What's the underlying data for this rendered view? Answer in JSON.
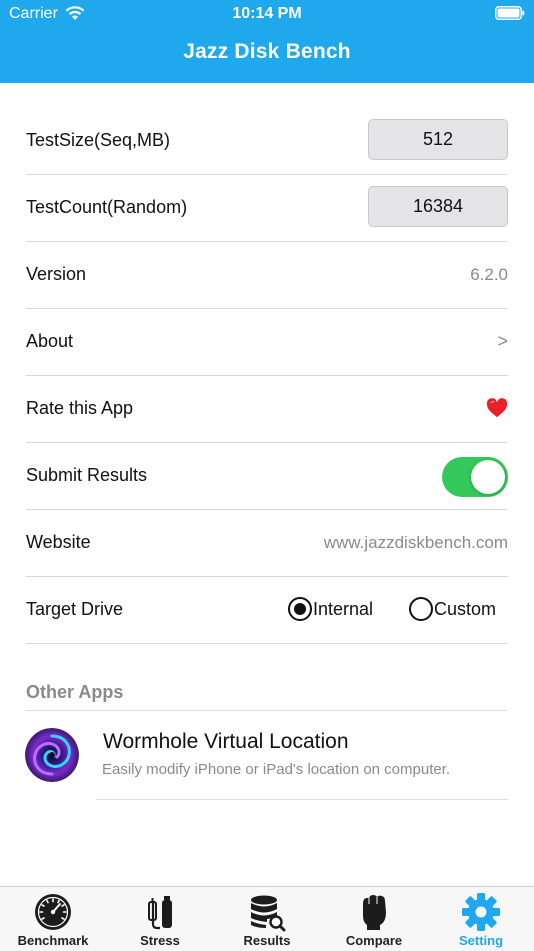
{
  "status_bar": {
    "carrier": "Carrier",
    "time": "10:14 PM"
  },
  "nav": {
    "title": "Jazz Disk Bench"
  },
  "settings": {
    "test_size": {
      "label": "TestSize(Seq,MB)",
      "value": "512"
    },
    "test_count": {
      "label": "TestCount(Random)",
      "value": "16384"
    },
    "version": {
      "label": "Version",
      "value": "6.2.0"
    },
    "about": {
      "label": "About",
      "chevron": ">"
    },
    "rate": {
      "label": "Rate this App",
      "icon": "heart-icon"
    },
    "submit": {
      "label": "Submit Results",
      "enabled": true
    },
    "website": {
      "label": "Website",
      "value": "www.jazzdiskbench.com"
    },
    "target_drive": {
      "label": "Target Drive",
      "options": [
        "Internal",
        "Custom"
      ],
      "selected": "Internal"
    }
  },
  "other_apps": {
    "header": "Other Apps",
    "items": [
      {
        "title": "Wormhole Virtual Location",
        "subtitle": "Easily modify iPhone or iPad's location on computer."
      }
    ]
  },
  "tabbar": {
    "items": [
      {
        "label": "Benchmark",
        "icon": "speedometer-icon"
      },
      {
        "label": "Stress",
        "icon": "stress-icon"
      },
      {
        "label": "Results",
        "icon": "database-search-icon"
      },
      {
        "label": "Compare",
        "icon": "fist-icon"
      },
      {
        "label": "Setting",
        "icon": "gear-icon"
      }
    ],
    "active": "Setting"
  },
  "colors": {
    "accent": "#20a8ec",
    "toggle_on": "#34c759",
    "heart": "#e8202a"
  }
}
